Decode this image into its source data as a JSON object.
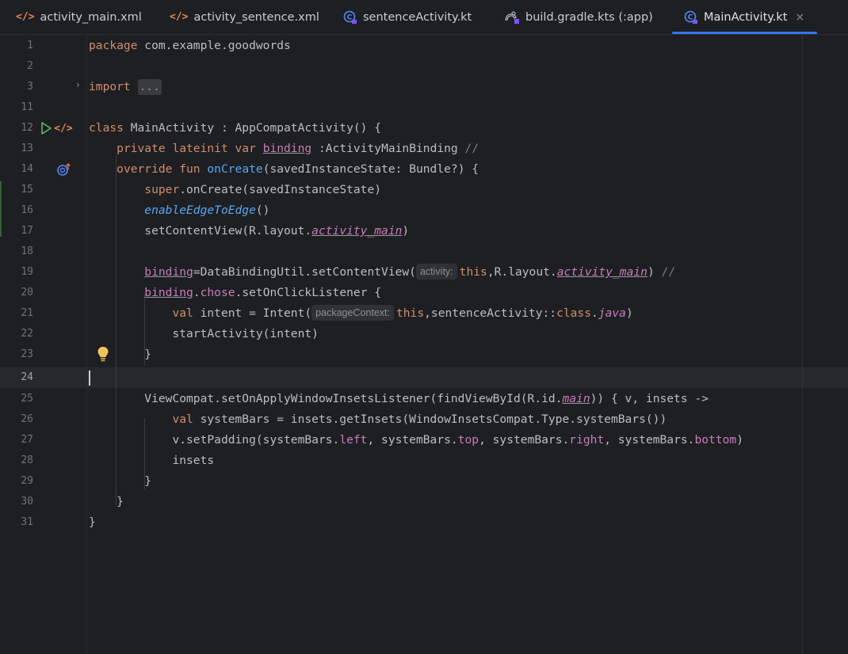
{
  "tabs": [
    {
      "label": "activity_main.xml",
      "icon": "xml-icon"
    },
    {
      "label": "activity_sentence.xml",
      "icon": "xml-icon"
    },
    {
      "label": "sentenceActivity.kt",
      "icon": "kotlin-class-icon"
    },
    {
      "label": "build.gradle.kts (:app)",
      "icon": "gradle-icon"
    },
    {
      "label": "MainActivity.kt",
      "icon": "kotlin-class-icon",
      "active": true,
      "close": "×"
    }
  ],
  "colors": {
    "background": "#1e1f22",
    "keyword": "#cf8e6d",
    "function": "#56a8f5",
    "property": "#c77dbb",
    "comment": "#7a7e85",
    "accent": "#3574f0"
  },
  "editor": {
    "current_line": "24",
    "lines": [
      {
        "n": "1",
        "t": {
          "kw1": "package",
          "rest": " com.example.goodwords"
        }
      },
      {
        "n": "2"
      },
      {
        "n": "3",
        "t": {
          "kw1": "import",
          "fold": "..."
        }
      },
      {
        "n": "11"
      },
      {
        "n": "12",
        "t": {
          "kw1": "class",
          "rest": " MainActivity : AppCompatActivity() {"
        }
      },
      {
        "n": "13",
        "t": {
          "kw1": "private lateinit var",
          "prop": "binding",
          "rest": " :ActivityMainBinding ",
          "cm": "//"
        }
      },
      {
        "n": "14",
        "t": {
          "kw1": "override fun",
          "fn": "onCreate",
          "rest": "(savedInstanceState: Bundle?) {"
        }
      },
      {
        "n": "15",
        "t": {
          "kw1": "super",
          "rest": ".onCreate(savedInstanceState)"
        }
      },
      {
        "n": "16",
        "t": {
          "fni": "enableEdgeToEdge",
          "rest": "()"
        }
      },
      {
        "n": "17",
        "t": {
          "a": "setContentView(R.layout.",
          "propi": "activity_main",
          "b": ")"
        }
      },
      {
        "n": "18"
      },
      {
        "n": "19",
        "t": {
          "prop": "binding",
          "a": "=DataBindingUtil.setContentView(",
          "hint": "activity:",
          "kw1": "this",
          "b": ",R.layout.",
          "propi": "activity_main",
          "c": ") ",
          "cm": "//"
        }
      },
      {
        "n": "20",
        "t": {
          "prop": "binding",
          "a": ".",
          "prop2": "chose",
          "b": ".setOnClickListener {"
        }
      },
      {
        "n": "21",
        "t": {
          "kw1": "val",
          "a": " intent = Intent(",
          "hint": "packageContext:",
          "kw2": "this",
          "b": ",sentenceActivity::",
          "kw3": "class",
          "c": ".",
          "propi": "java",
          "d": ")"
        }
      },
      {
        "n": "22",
        "t": {
          "rest": "startActivity(intent)"
        }
      },
      {
        "n": "23",
        "t": {
          "rest": "}"
        }
      },
      {
        "n": "24"
      },
      {
        "n": "25",
        "t": {
          "a": "ViewCompat.setOnApplyWindowInsetsListener(findViewById(R.id.",
          "propi": "main",
          "b": ")) { v, insets ->"
        }
      },
      {
        "n": "26",
        "t": {
          "kw1": "val",
          "rest": " systemBars = insets.getInsets(WindowInsetsCompat.Type.systemBars())"
        }
      },
      {
        "n": "27",
        "t": {
          "a": "v.setPadding(systemBars.",
          "p1": "left",
          "b": ", systemBars.",
          "p2": "top",
          "c": ", systemBars.",
          "p3": "right",
          "d": ", systemBars.",
          "p4": "bottom",
          "e": ")"
        }
      },
      {
        "n": "28",
        "t": {
          "rest": "insets"
        }
      },
      {
        "n": "29",
        "t": {
          "rest": "}"
        }
      },
      {
        "n": "30",
        "t": {
          "rest": "}"
        }
      },
      {
        "n": "31",
        "t": {
          "rest": "}"
        }
      }
    ]
  }
}
